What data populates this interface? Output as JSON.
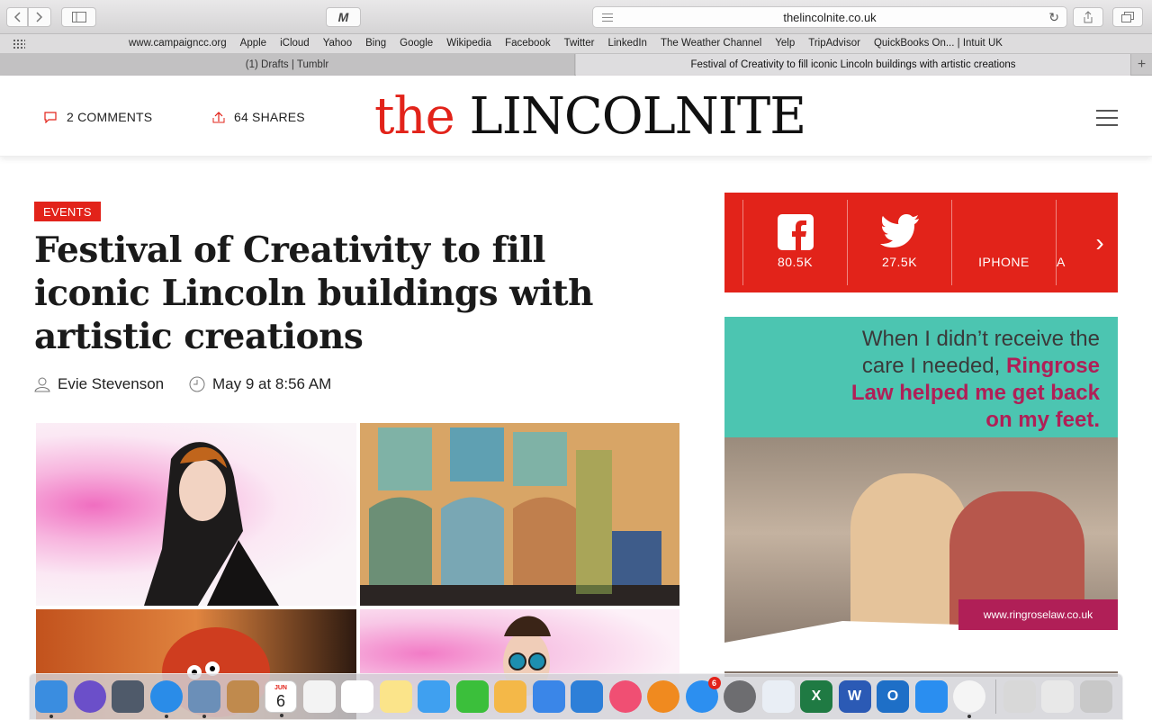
{
  "browser": {
    "url": "thelincolnite.co.uk",
    "favorites": [
      "www.campaigncc.org",
      "Apple",
      "iCloud",
      "Yahoo",
      "Bing",
      "Google",
      "Wikipedia",
      "Facebook",
      "Twitter",
      "LinkedIn",
      "The Weather Channel",
      "Yelp",
      "TripAdvisor",
      "QuickBooks On... | Intuit UK"
    ],
    "tabs": [
      {
        "title": "(1) Drafts | Tumblr"
      },
      {
        "title": "Festival of Creativity to fill iconic Lincoln buildings with artistic creations"
      }
    ]
  },
  "site": {
    "comments": "2 COMMENTS",
    "shares": "64 SHARES",
    "logo_the": "the",
    "logo_name": "LINCOLNITE"
  },
  "article": {
    "category": "EVENTS",
    "title": "Festival of Creativity to fill iconic Lincoln buildings with artistic creations",
    "author": "Evie Stevenson",
    "date": "May 9 at 8:56 AM"
  },
  "share_bar": {
    "items": [
      {
        "icon": "facebook-icon",
        "label": "80.5K"
      },
      {
        "icon": "twitter-icon",
        "label": "27.5K"
      },
      {
        "icon": "",
        "label": "IPHONE"
      },
      {
        "icon": "",
        "label": "A"
      }
    ]
  },
  "ad": {
    "line1": "When I didn’t receive the care I needed,",
    "highlight": "Ringrose Law helped me get back on my feet.",
    "url": "www.ringroselaw.co.uk"
  },
  "dock": {
    "calendar_month": "JUN",
    "calendar_day": "6",
    "appstore_badge": "6",
    "colors": [
      "#3a8de0",
      "#6b4fc9",
      "#4f5a6a",
      "#2a8ce8",
      "#6b8fb8",
      "#c08a4d",
      "#ffffff",
      "#f3f3f3",
      "#ffffff",
      "#fbe48a",
      "#3fa0f0",
      "#3bbf3b",
      "#f4b848",
      "#3a86e8",
      "#2d7fd8",
      "#f04f73",
      "#f08a1f",
      "#2c8ff0",
      "#6d6d70",
      "#e9eef5",
      "#1f7a43",
      "#2b5ab5",
      "#1e6fc7",
      "#2a8ef0",
      "#f5f5f5",
      "#d8d8d8",
      "#e8e8e8",
      "#c8c8c8"
    ]
  }
}
